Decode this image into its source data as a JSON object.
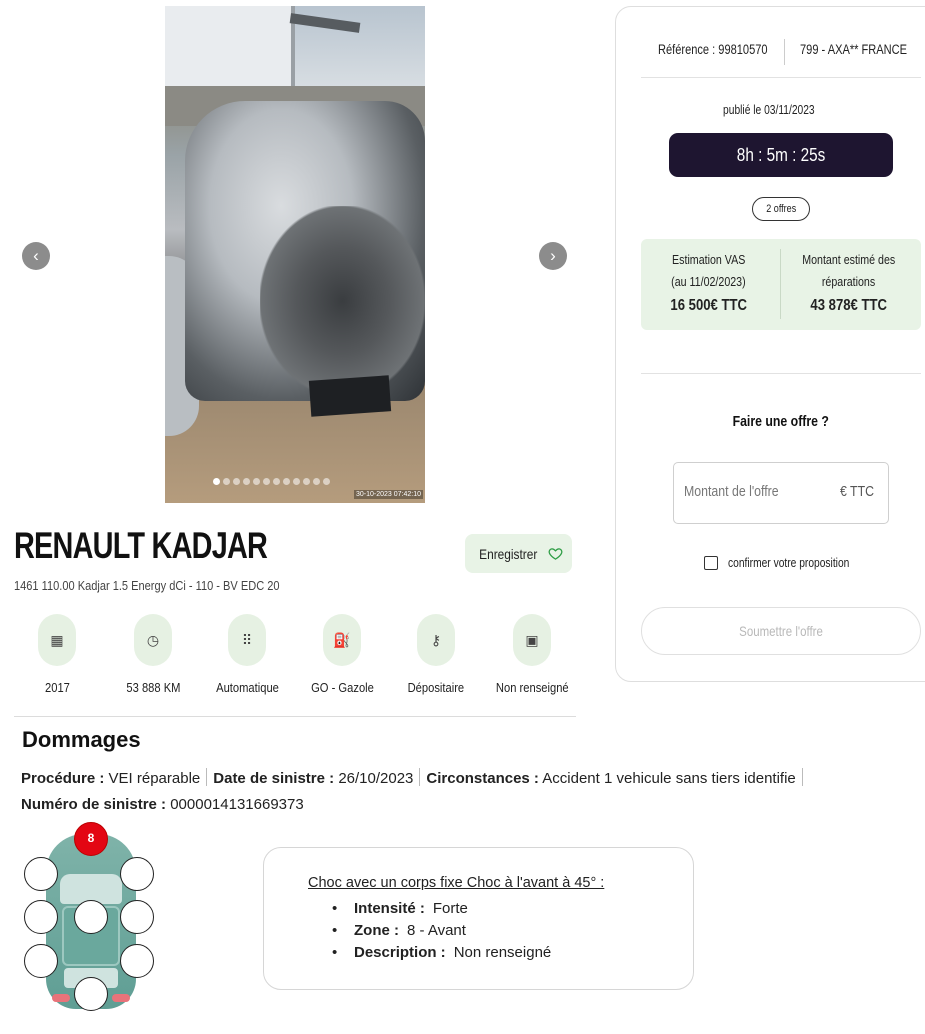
{
  "gallery": {
    "prev_icon": "‹",
    "next_icon": "›",
    "photo_timestamp": "30-10-2023 07:42:10",
    "dots_count": 12
  },
  "vehicle": {
    "title": "RENAULT KADJAR",
    "subtitle": "1461 110.00 Kadjar 1.5 Energy dCi - 110 - BV EDC 20",
    "save_label": "Enregistrer",
    "specs": [
      {
        "icon": "calendar-icon",
        "glyph": "▦",
        "value": "2017"
      },
      {
        "icon": "speedometer-icon",
        "glyph": "◷",
        "value": "53 888 KM"
      },
      {
        "icon": "gearbox-icon",
        "glyph": "⠿",
        "value": "Automatique"
      },
      {
        "icon": "fuel-pump-icon",
        "glyph": "⛽",
        "value": "GO - Gazole"
      },
      {
        "icon": "key-icon",
        "glyph": "⚷",
        "value": "Dépositaire"
      },
      {
        "icon": "document-icon",
        "glyph": "▣",
        "value": "Non renseigné"
      }
    ]
  },
  "damages": {
    "title": "Dommages",
    "procedure_label": "Procédure :",
    "procedure_value": "VEI réparable",
    "date_label": "Date de sinistre :",
    "date_value": "26/10/2023",
    "circ_label": "Circonstances :",
    "circ_value": "Accident 1 vehicule sans tiers identifie",
    "claim_label": "Numéro de sinistre :",
    "claim_value": "0000014131669373",
    "active_zone": "8",
    "choc": {
      "title": "Choc avec un corps fixe Choc à l'avant à 45° :",
      "items": [
        {
          "label": "Intensité :",
          "value": "Forte"
        },
        {
          "label": "Zone :",
          "value": "8 - Avant"
        },
        {
          "label": "Description :",
          "value": "Non renseigné"
        }
      ]
    }
  },
  "panel": {
    "reference": "Référence : 99810570",
    "insurer": "799 - AXA** FRANCE",
    "published": "publié le 03/11/2023",
    "countdown": "8h : 5m : 25s",
    "offers": "2 offres",
    "estimate_title_1": "Estimation VAS",
    "estimate_title_2": "(au 11/02/2023)",
    "estimate_value": "16 500€ TTC",
    "repair_title_1": "Montant estimé des",
    "repair_title_2": "réparations",
    "repair_value": "43 878€ TTC",
    "offer_title": "Faire une offre ?",
    "amount_placeholder": "Montant de l'offre",
    "amount_unit": "€ TTC",
    "confirm_label": "confirmer votre proposition",
    "submit_label": "Soumettre l'offre"
  },
  "colors": {
    "accent_green_bg": "#e8f3e6",
    "timer_bg": "#1e1530",
    "zone_active": "#e30613"
  }
}
